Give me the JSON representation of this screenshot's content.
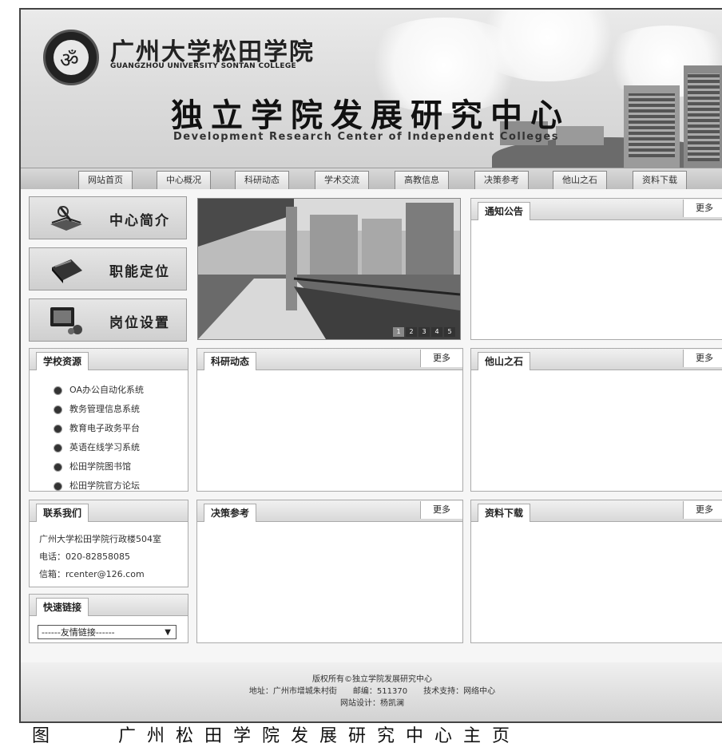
{
  "header": {
    "university_cn": "广州大学松田学院",
    "university_en": "GUANGZHOU UNIVERSITY SONTAN COLLEGE",
    "center_cn": "独立学院发展研究中心",
    "center_en": "Development Research Center of Independent Colleges"
  },
  "nav": [
    "网站首页",
    "中心概况",
    "科研动态",
    "学术交流",
    "高教信息",
    "决策参考",
    "他山之石",
    "资料下载"
  ],
  "side_buttons": [
    {
      "label": "中心简介",
      "icon": "book-pen-icon"
    },
    {
      "label": "职能定位",
      "icon": "folder-icon"
    },
    {
      "label": "岗位设置",
      "icon": "computer-icon"
    }
  ],
  "photo": {
    "pages": [
      "1",
      "2",
      "3",
      "4",
      "5"
    ],
    "active": "1"
  },
  "panels": {
    "notice": {
      "title": "通知公告",
      "more": "更多"
    },
    "research": {
      "title": "科研动态",
      "more": "更多"
    },
    "others": {
      "title": "他山之石",
      "more": "更多"
    },
    "decision": {
      "title": "决策参考",
      "more": "更多"
    },
    "download": {
      "title": "资料下载",
      "more": "更多"
    }
  },
  "resources": {
    "title": "学校资源",
    "items": [
      "OA办公自动化系统",
      "教务管理信息系统",
      "教育电子政务平台",
      "英语在线学习系统",
      "松田学院图书馆",
      "松田学院官方论坛"
    ]
  },
  "contact": {
    "title": "联系我们",
    "address": "广州大学松田学院行政楼504室",
    "phone": "电话：020-82858085",
    "email": "信箱：rcenter@126.com"
  },
  "quick_links": {
    "title": "快速链接",
    "selected": "------友情链接------"
  },
  "footer": {
    "copyright": "版权所有©独立学院发展研究中心",
    "address": "地址：广州市增城朱村街　　邮编：511370　　技术支持：网络中心",
    "designer": "网站设计：杨凯澜"
  },
  "caption": "图　　广州松田学院发展研究中心主页"
}
